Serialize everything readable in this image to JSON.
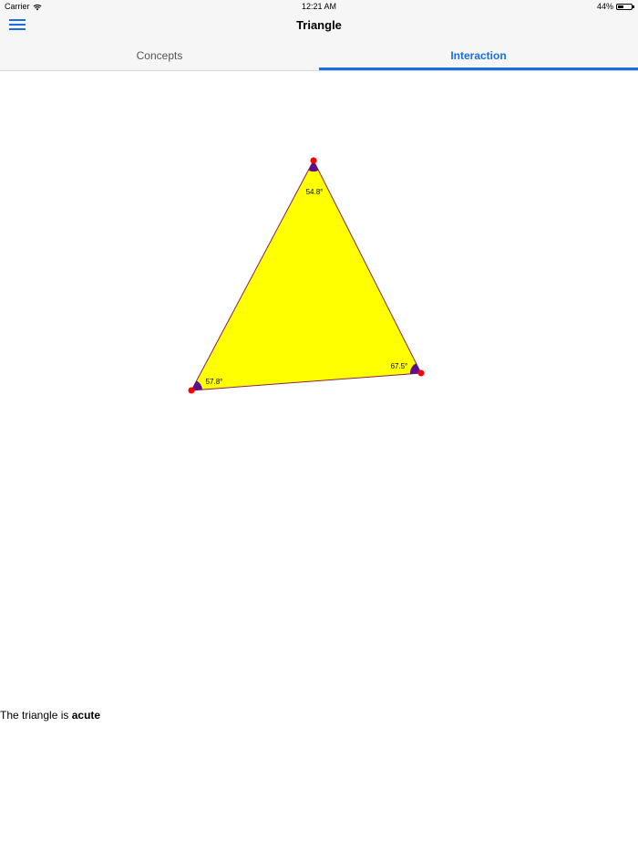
{
  "status_bar": {
    "carrier": "Carrier",
    "time": "12:21 AM",
    "battery": "44%",
    "battery_level": 0.44
  },
  "nav": {
    "title": "Triangle",
    "menu_icon": "hamburger-menu-icon"
  },
  "tabs": [
    {
      "label": "Concepts",
      "selected": false
    },
    {
      "label": "Interaction",
      "selected": true
    }
  ],
  "colors": {
    "accent": "#1a6fe0",
    "triangle_fill": "#ffff00",
    "triangle_stroke": "#8b2252",
    "angle_marker": "#5b0f8a",
    "vertex_handle": "#ff0000"
  },
  "triangle": {
    "angles": [
      {
        "label": "54.8°"
      },
      {
        "label": "67.5°"
      },
      {
        "label": "57.8°"
      }
    ]
  },
  "result": {
    "prefix": "The triangle is",
    "classification": "acute"
  }
}
